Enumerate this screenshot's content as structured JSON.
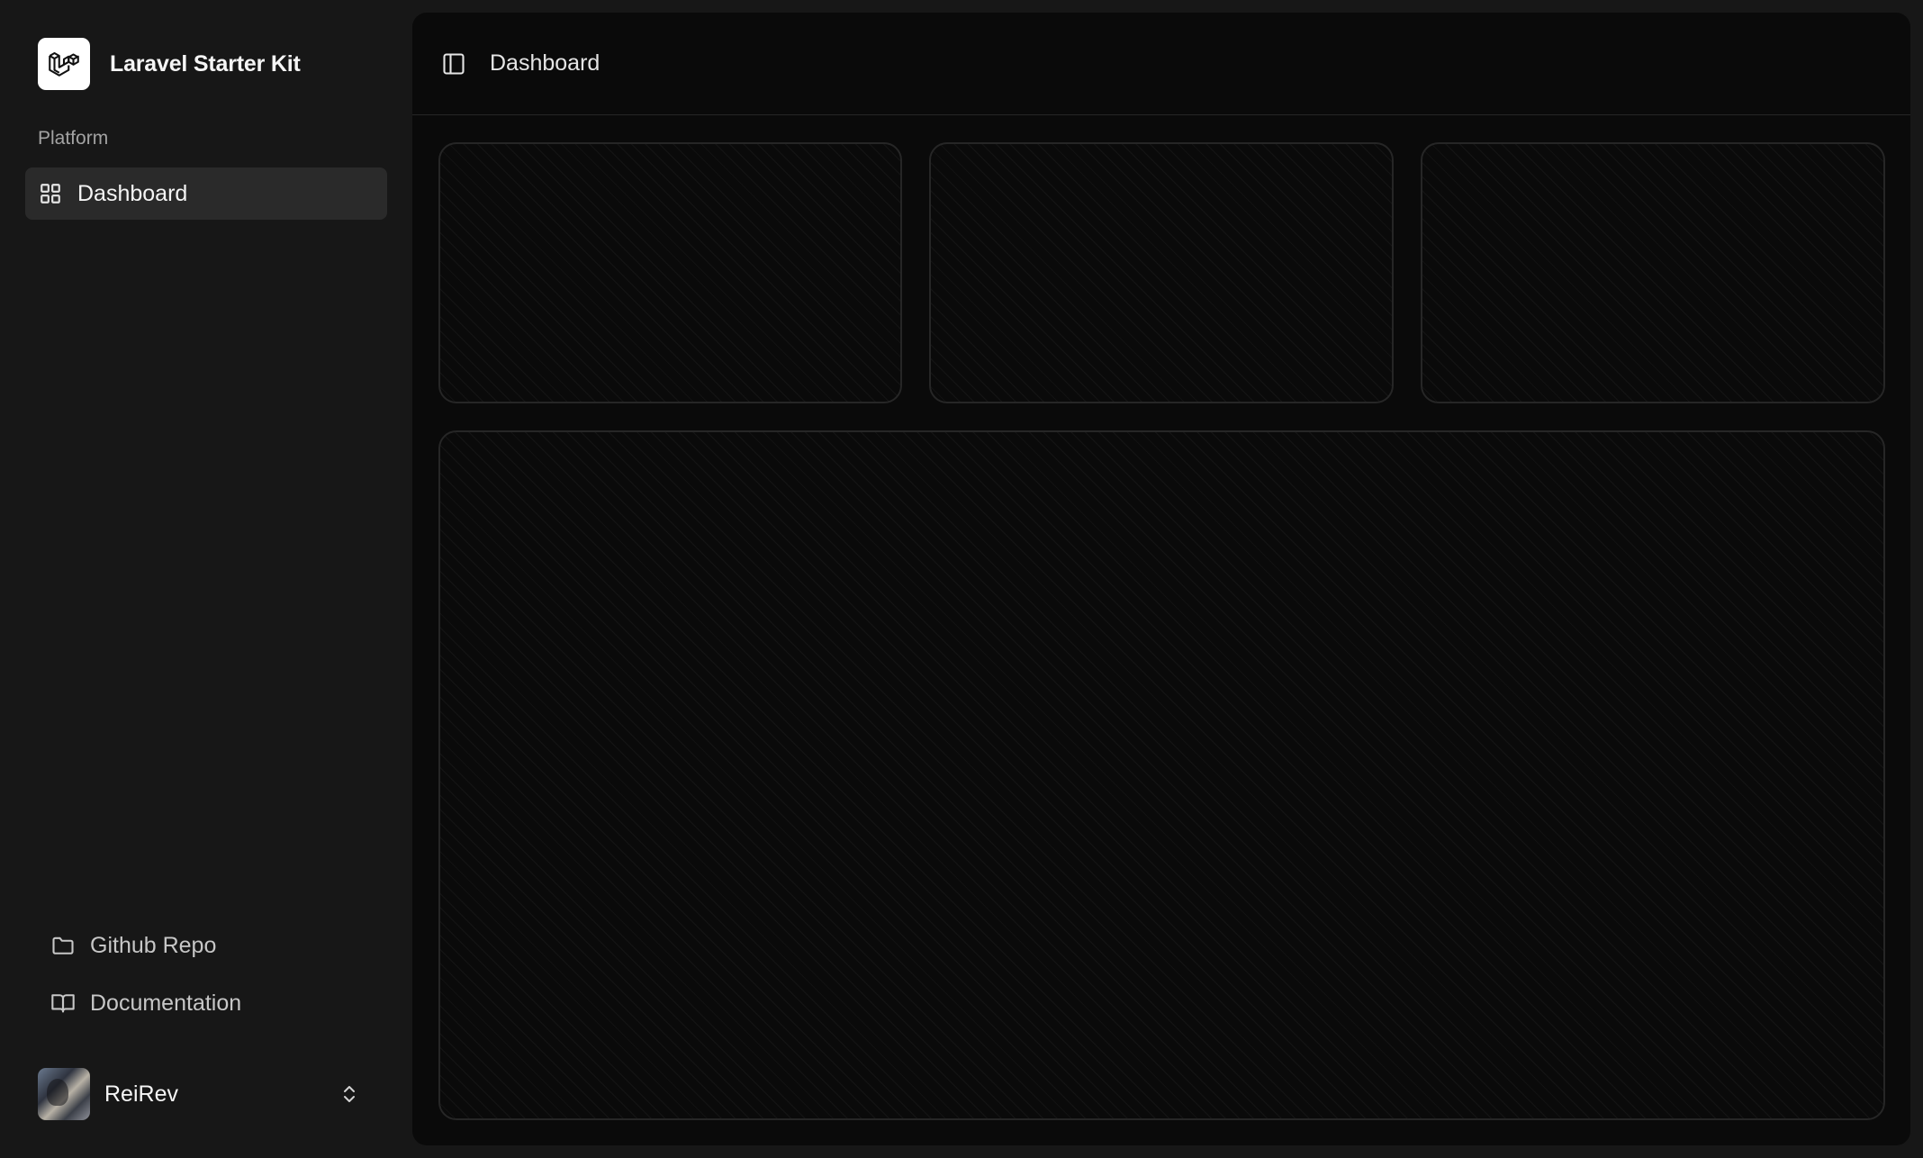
{
  "app": {
    "name": "Laravel Starter Kit"
  },
  "sidebar": {
    "group_label": "Platform",
    "items": [
      {
        "label": "Dashboard",
        "icon": "layout-grid-icon",
        "active": true
      }
    ],
    "footer_links": [
      {
        "label": "Github Repo",
        "icon": "folder-icon"
      },
      {
        "label": "Documentation",
        "icon": "book-open-icon"
      }
    ],
    "user": {
      "name": "ReiRev"
    }
  },
  "header": {
    "breadcrumb": "Dashboard"
  },
  "colors": {
    "sidebar_bg": "#171717",
    "main_bg": "#0a0a0a",
    "active_item_bg": "#2a2a2a",
    "border": "#262626",
    "text": "#ededed",
    "muted_text": "#a3a3a3"
  }
}
